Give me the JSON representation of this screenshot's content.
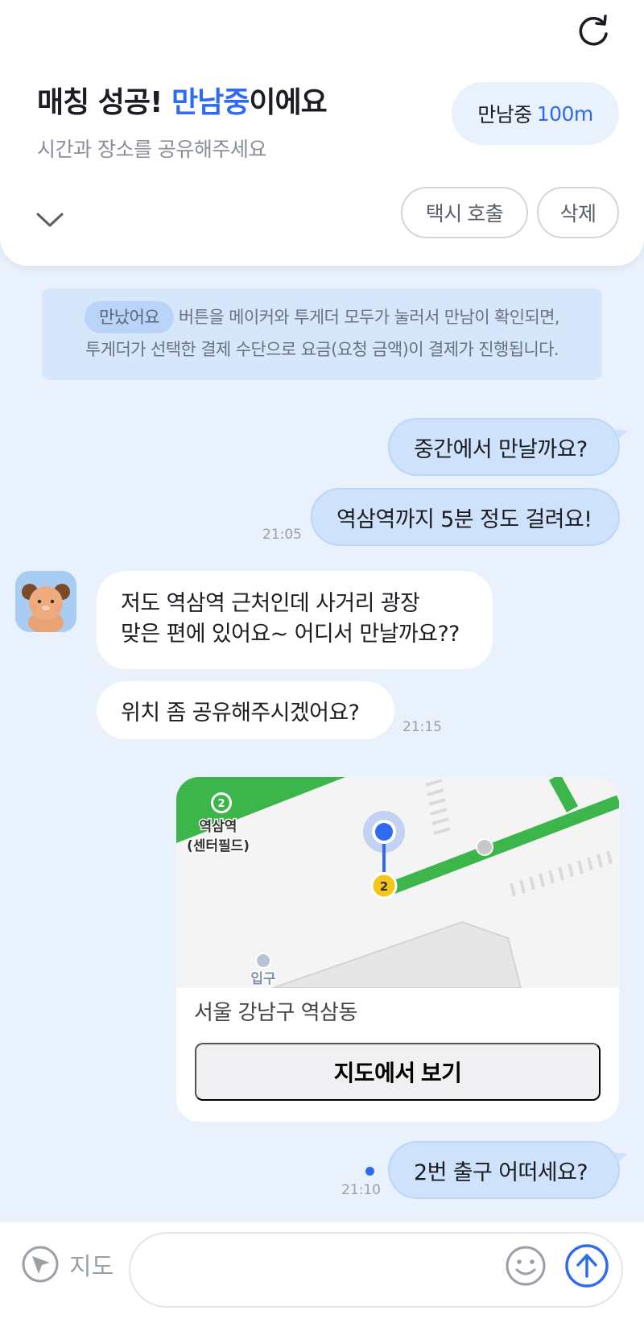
{
  "header": {
    "title_prefix": "매칭 성공! ",
    "title_highlight": "만남중",
    "title_suffix": "이에요",
    "subtitle": "시간과 장소를 공유해주세요",
    "status_label": "만남중",
    "distance": "100m",
    "taxi_button": "택시 호출",
    "delete_button": "삭제"
  },
  "notice": {
    "chip": "만났어요",
    "line1": "버튼을 메이커와 투게더 모두가 눌러서 만남이 확인되면,",
    "line2": "투게더가 선택한 결제 수단으로 요금(요청 금액)이 결제가 진행됩니다."
  },
  "messages": [
    {
      "sender": "me",
      "text": "중간에서 만날까요?"
    },
    {
      "sender": "me",
      "text": "역삼역까지 5분 정도 걸려요!",
      "time": "21:05"
    },
    {
      "sender": "other",
      "line1": "저도 역삼역 근처인데 사거리 광장",
      "line2": "맞은 편에 있어요~ 어디서 만날까요??"
    },
    {
      "sender": "other",
      "text": "위치 좀 공유해주시겠어요?",
      "time": "21:15"
    },
    {
      "sender": "me",
      "text": "2번 출구 어떠세요?",
      "time": "21:10"
    }
  ],
  "location_card": {
    "station_line": "2",
    "station_name": "역삼역",
    "station_sub": "(센터필드)",
    "exit_number": "2",
    "entrance_label": "입구",
    "address": "서울 강남구 역삼동",
    "view_button": "지도에서 보기"
  },
  "bottom_bar": {
    "map_label": "지도",
    "input_placeholder": ""
  },
  "colors": {
    "accent": "#2f6bf0",
    "background": "#e8f1fc",
    "my_bubble": "#cfe2fb",
    "subway_green": "#3cb54a"
  },
  "icons": [
    "refresh-icon",
    "chevron-down-icon",
    "navigation-icon",
    "smile-icon",
    "send-arrow-icon"
  ]
}
